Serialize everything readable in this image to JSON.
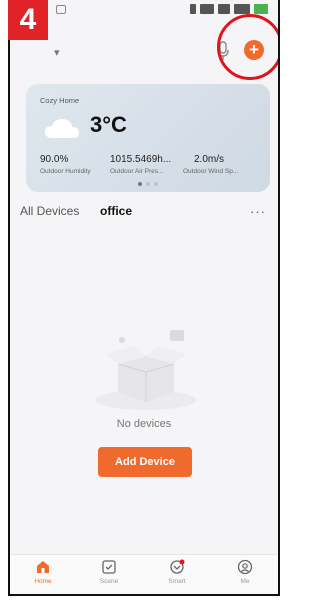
{
  "step_badge": "4",
  "colors": {
    "accent": "#ef6a2c",
    "highlight": "#e0141b",
    "badge": "#e12227"
  },
  "header": {
    "add_button_label": "+",
    "icons": [
      "microphone-icon",
      "add-icon"
    ]
  },
  "weather": {
    "home_name": "Cozy Home",
    "temperature": "3°C",
    "stats": [
      {
        "value": "90.0%",
        "label": "Outdoor Humidity"
      },
      {
        "value": "1015.5469h...",
        "label": "Outdoor Air Pres..."
      },
      {
        "value": "2.0m/s",
        "label": "Outdoor Wind Sp..."
      }
    ]
  },
  "tabs": {
    "all": "All Devices",
    "office": "office",
    "more": "···"
  },
  "empty_state": {
    "message": "No devices",
    "button": "Add Device"
  },
  "bottom_nav": [
    {
      "label": "Home",
      "icon": "home-icon",
      "active": true
    },
    {
      "label": "Scene",
      "icon": "scene-icon",
      "active": false
    },
    {
      "label": "Smart",
      "icon": "smart-icon",
      "active": false
    },
    {
      "label": "Me",
      "icon": "me-icon",
      "active": false
    }
  ]
}
